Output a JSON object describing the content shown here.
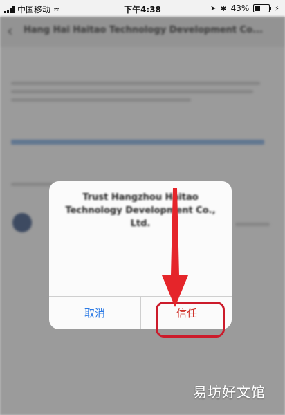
{
  "status_bar": {
    "carrier": "中国移动",
    "time": "下午4:38",
    "battery": "43%",
    "icons": [
      "signal-icon",
      "wifi-icon",
      "location-icon",
      "bluetooth-icon",
      "charging-icon",
      "battery-icon"
    ]
  },
  "background_page": {
    "title": "Hang Hai Haitao Technology Development Co..."
  },
  "alert": {
    "title": "Trust Hangzhou Haitao Technology Development Co., Ltd.",
    "message": "",
    "cancel_label": "取消",
    "trust_label": "信任"
  },
  "watermark": "易坊好文馆",
  "colors": {
    "ios_blue": "#2d7be5",
    "trust_red": "#d0342c",
    "highlight_red": "#cc1b2b"
  }
}
